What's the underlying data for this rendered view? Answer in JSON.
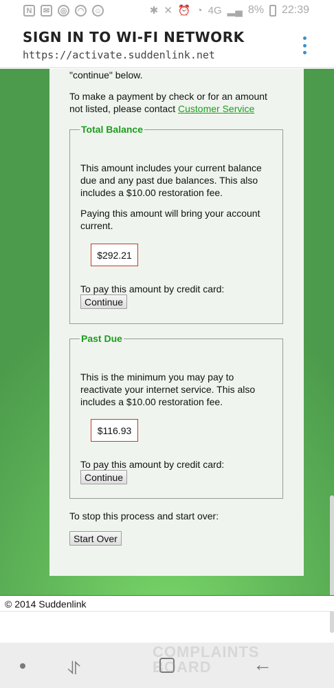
{
  "status_bar": {
    "battery_percent": "8%",
    "time": "22:39",
    "signal_label": "4G"
  },
  "browser": {
    "title": "SIGN IN TO WI-FI NETWORK",
    "url": "https://activate.suddenlink.net"
  },
  "page": {
    "intro_tail": "\"continue\" below.",
    "payment_note_pre": "To make a payment by check or for an amount",
    "payment_note_line2": "not listed, please contact ",
    "customer_service_link": "Customer Service",
    "total_balance": {
      "legend": "Total Balance",
      "desc_l1": "This amount includes your current balance",
      "desc_l2": "due and any past due balances. This also",
      "desc_l3": "includes a $10.00 restoration fee.",
      "note_l1": "Paying this amount will bring your account",
      "note_l2": "current.",
      "amount": "$292.21",
      "pay_label": "To pay this amount by credit card:",
      "button": "Continue"
    },
    "past_due": {
      "legend": "Past Due",
      "desc_l1": "This is the minimum you may pay to",
      "desc_l2": "reactivate your internet service. This also",
      "desc_l3": "includes a $10.00 restoration fee.",
      "amount": "$116.93",
      "pay_label": "To pay this amount by credit card:",
      "button": "Continue"
    },
    "stop_label": "To stop this process and start over:",
    "start_over_button": "Start Over"
  },
  "footer": {
    "copyright": "© 2014 Suddenlink"
  },
  "watermark": {
    "line1": "COMPLAINTS",
    "line2": "BOARD"
  },
  "colors": {
    "link": "#1e9c1e",
    "legend": "#1e9c1e",
    "amount_border": "#c0392b",
    "background_green": "#62b85a"
  }
}
